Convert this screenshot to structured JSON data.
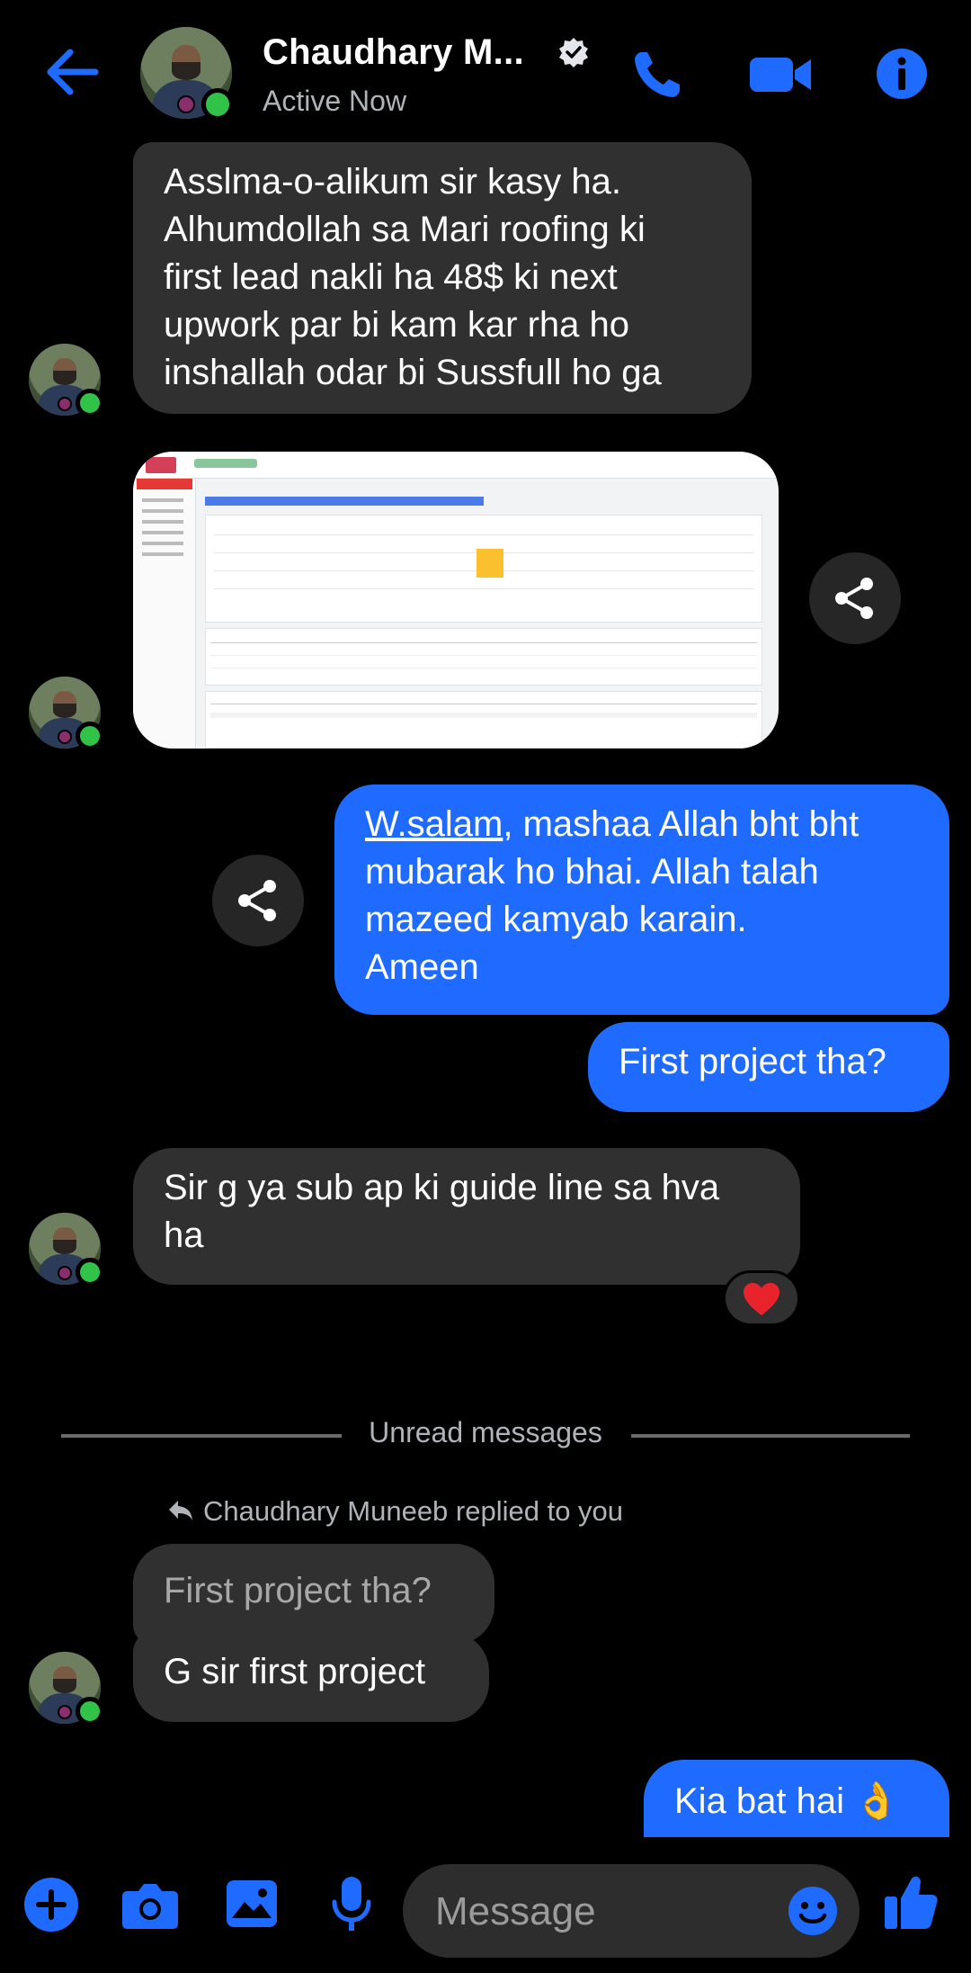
{
  "header": {
    "contact_name": "Chaudhary M...",
    "status": "Active Now",
    "back_icon": "arrow-left-icon",
    "call_icon": "phone-icon",
    "video_icon": "video-camera-icon",
    "info_icon": "info-icon",
    "accent_color": "#1f6bff"
  },
  "messages": [
    {
      "direction": "in",
      "text": "Asslma-o-alikum sir kasy ha.\nAlhumdollah sa Mari roofing ki\nfirst lead nakli ha 48$ ki next\nupwork par bi kam kar rha ho\ninshallah odar bi Sussfull ho ga"
    },
    {
      "direction": "in",
      "type": "image"
    },
    {
      "direction": "out",
      "text_link": "W.salam",
      "text": ", mashaa Allah bht bht\nmubarak ho bhai. Allah talah\nmazeed kamyab karain.\nAmeen"
    },
    {
      "direction": "out",
      "text": "First project tha?"
    },
    {
      "direction": "in",
      "text": "Sir g ya sub ap ki guide line sa hva\nha",
      "reaction": "heart"
    },
    {
      "direction": "in",
      "quoted": "First project tha?",
      "text": "G sir first project"
    },
    {
      "direction": "out",
      "text": "Kia bat hai 👌"
    }
  ],
  "unread_label": "Unread messages",
  "reply_notice": "Chaudhary Muneeb replied to you",
  "composer": {
    "placeholder": "Message",
    "icons": [
      "plus-icon",
      "camera-icon",
      "image-icon",
      "microphone-icon",
      "emoji-icon",
      "thumbs-up-icon"
    ]
  }
}
